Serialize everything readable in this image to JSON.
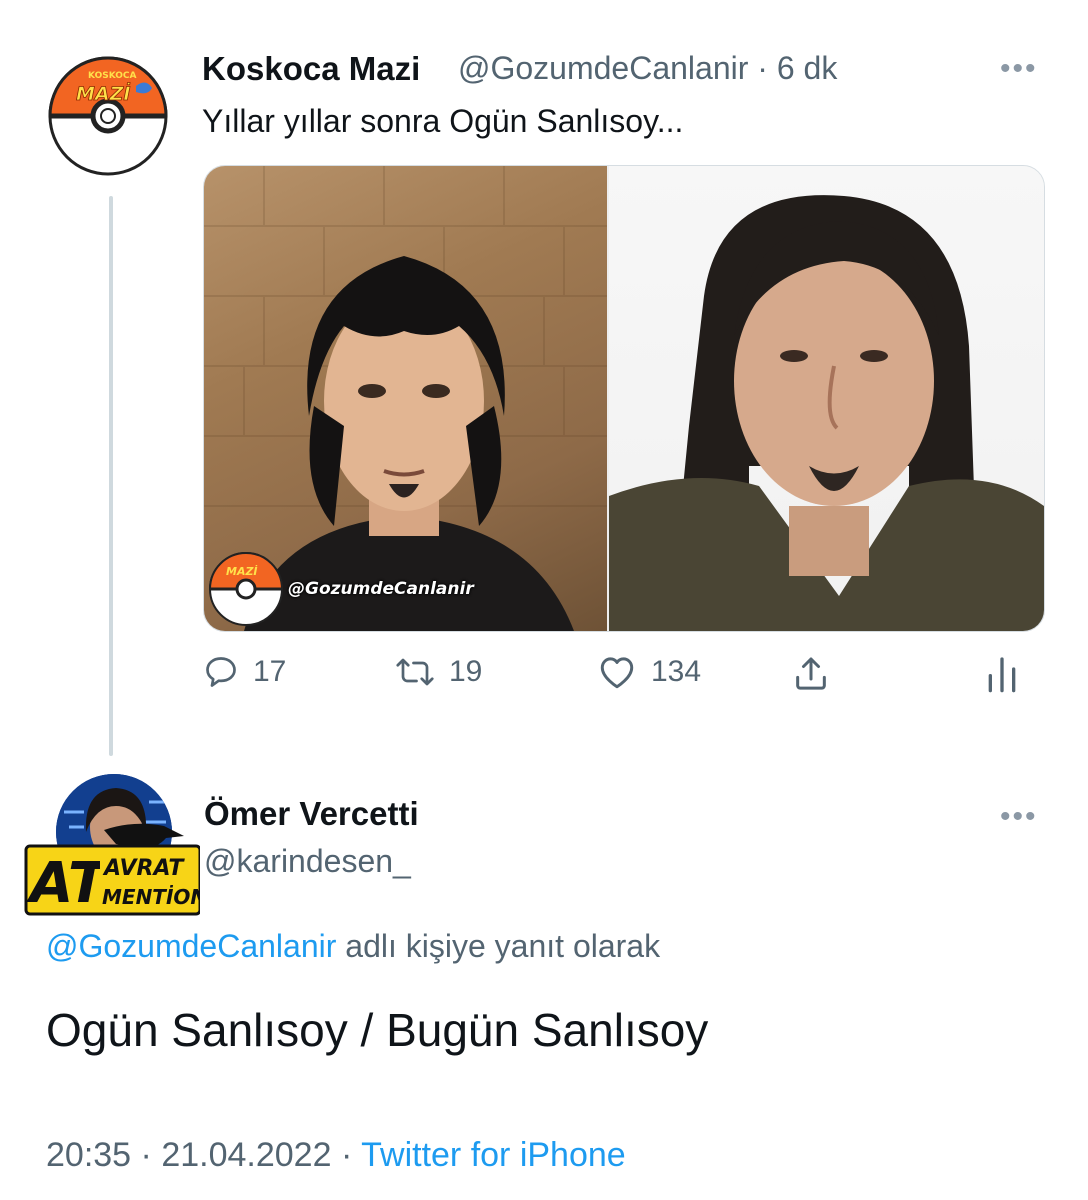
{
  "tweet": {
    "author_name": "Koskoca Mazi",
    "author_handle": "@GozumdeCanlanir",
    "separator": "·",
    "time": "6 dk",
    "text": "Yıllar yıllar sonra Ogün Sanlısoy...",
    "avatar_logo_text_top": "KOSKOCA",
    "avatar_logo_text": "MAZİ",
    "media_watermark": "@GozumdeCanlanir",
    "media_watermark_logo": "MAZİ",
    "more_label": "•••",
    "actions": {
      "reply_count": "17",
      "retweet_count": "19",
      "like_count": "134"
    }
  },
  "reply": {
    "author_name": "Ömer Vercetti",
    "author_handle": "@karindesen_",
    "more_label": "•••",
    "avatar_badge_big": "AT",
    "avatar_badge_top": "AVRAT",
    "avatar_badge_bottom": "MENTİON",
    "replying_to_handle": "@GozumdeCanlanir",
    "replying_to_suffix": " adlı kişiye yanıt olarak",
    "text": "Ogün Sanlısoy / Bugün Sanlısoy",
    "time": "20:35",
    "date": "21.04.2022",
    "separator": "·",
    "source": "Twitter for iPhone"
  },
  "colors": {
    "accent": "#1d9bf0",
    "secondary_text": "#536471",
    "primary_text": "#0f1419",
    "icon": "#536471",
    "thread_line": "#cfd9de",
    "logo_orange": "#f26522",
    "badge_yellow": "#f7d417"
  }
}
